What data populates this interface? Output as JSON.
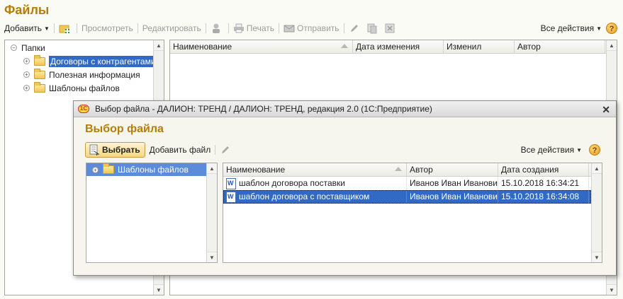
{
  "page": {
    "title": "Файлы",
    "toolbar": {
      "add": "Добавить",
      "view": "Просмотреть",
      "edit": "Редактировать",
      "print": "Печать",
      "send": "Отправить",
      "all_actions": "Все действия",
      "help": "?"
    },
    "tree": {
      "root": "Папки",
      "items": [
        {
          "label": "Договоры с контрагентами",
          "selected": true
        },
        {
          "label": "Полезная информация",
          "selected": false
        },
        {
          "label": "Шаблоны файлов",
          "selected": false
        }
      ]
    },
    "grid": {
      "columns": [
        "Наименование",
        "Дата изменения",
        "Изменил",
        "Автор"
      ]
    }
  },
  "dialog": {
    "window_title": "Выбор файла - ДАЛИОН: ТРЕНД / ДАЛИОН: ТРЕНД, редакция 2.0  (1С:Предприятие)",
    "logo": "1С",
    "header": "Выбор файла",
    "toolbar": {
      "select": "Выбрать",
      "add_file": "Добавить файл",
      "all_actions": "Все действия",
      "help": "?"
    },
    "tree": {
      "items": [
        {
          "label": "Шаблоны файлов",
          "selected": true
        }
      ]
    },
    "grid": {
      "columns": [
        "Наименование",
        "Автор",
        "Дата создания"
      ],
      "rows": [
        {
          "name": "шаблон договора поставки",
          "author": "Иванов Иван Иванович",
          "created": "15.10.2018 16:34:21",
          "selected": false
        },
        {
          "name": "шаблон договора с поставщиком",
          "author": "Иванов Иван Иванович",
          "created": "15.10.2018 16:34:08",
          "selected": true
        }
      ]
    }
  },
  "colors": {
    "accent": "#b67d0a",
    "selection": "#316ac5"
  }
}
